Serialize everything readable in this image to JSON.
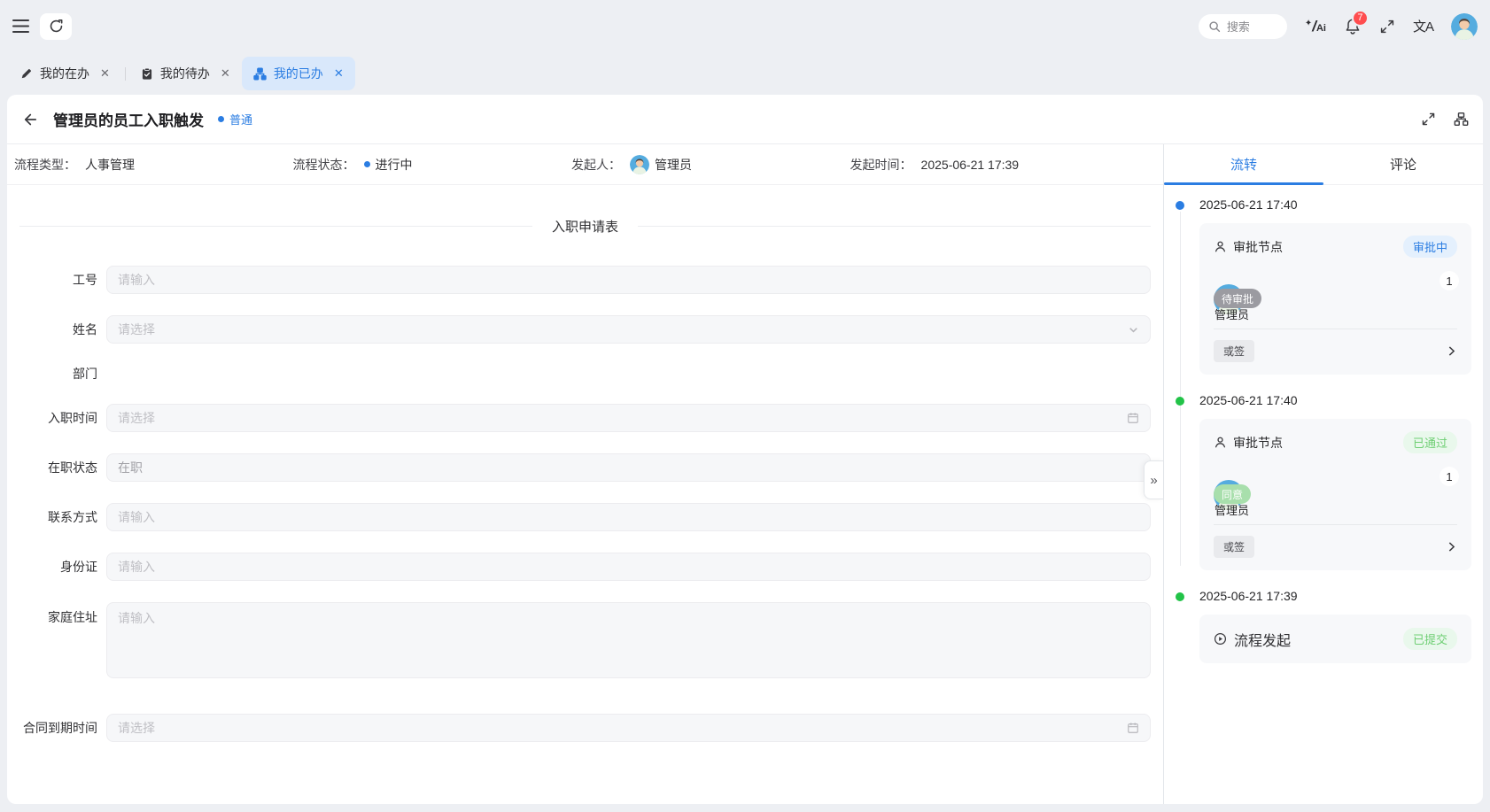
{
  "colors": {
    "accent": "#2b7de2",
    "accent_light_bg": "#d9e8fb",
    "success": "#22c348",
    "success_text": "#6fcf74",
    "success_bg": "#e9f8ec",
    "danger": "#ff4d4f",
    "pending_gray": "#9b9ba1",
    "agree_green": "#a8dfac"
  },
  "icons": {
    "menu-icon": "hamburger",
    "refresh-icon": "circular-arrow",
    "search-icon": "magnifier",
    "ai-assistant-icon": "sparkle-slash-Ai",
    "bell-icon": "bell",
    "fullscreen-icon": "corner-arrows",
    "translate-icon": "文A",
    "pencil-icon": "edit-pen",
    "clipboard-check-icon": "task-board",
    "flowchart-icon": "org-chart",
    "back-arrow-icon": "left-arrow",
    "person-icon": "user-outline",
    "play-circle-icon": "circled-play",
    "calendar-icon": "calendar",
    "chevron-down-icon": "v",
    "chevron-right-icon": ">",
    "collapse-icon": "»"
  },
  "topbar": {
    "search_placeholder": "搜索",
    "notification_count": "7",
    "ai_label": "Ai",
    "translate_label": "文A"
  },
  "tabs": [
    {
      "label": "我的在办"
    },
    {
      "label": "我的待办"
    },
    {
      "label": "我的已办"
    }
  ],
  "page": {
    "title": "管理员的员工入职触发",
    "priority_badge": "普通"
  },
  "meta": {
    "type_label": "流程类型：",
    "type_value": "人事管理",
    "status_label": "流程状态：",
    "status_value": "进行中",
    "initiator_label": "发起人：",
    "initiator_value": "管理员",
    "time_label": "发起时间：",
    "time_value": "2025-06-21 17:39"
  },
  "form": {
    "title": "入职申请表",
    "fields": [
      {
        "label": "工号",
        "placeholder": "请输入",
        "type": "input"
      },
      {
        "label": "姓名",
        "placeholder": "请选择",
        "type": "select"
      },
      {
        "label": "部门",
        "type": "label-only"
      },
      {
        "label": "入职时间",
        "placeholder": "请选择",
        "type": "date"
      },
      {
        "label": "在职状态",
        "value": "在职",
        "type": "input"
      },
      {
        "label": "联系方式",
        "placeholder": "请输入",
        "type": "input"
      },
      {
        "label": "身份证",
        "placeholder": "请输入",
        "type": "input"
      },
      {
        "label": "家庭住址",
        "placeholder": "请输入",
        "type": "textarea"
      },
      {
        "label": "合同到期时间",
        "placeholder": "请选择",
        "type": "date"
      }
    ]
  },
  "panel": {
    "tabs": [
      {
        "label": "流转"
      },
      {
        "label": "评论"
      }
    ],
    "timeline": [
      {
        "date": "2025-06-21 17:40",
        "dot": "blue",
        "node_label": "审批节点",
        "status_badge": "审批中",
        "person_name": "管理员",
        "person_status": "待审批",
        "count": "1",
        "sign_mode": "或签"
      },
      {
        "date": "2025-06-21 17:40",
        "dot": "green",
        "node_label": "审批节点",
        "status_badge": "已通过",
        "person_name": "管理员",
        "person_status": "同意",
        "count": "1",
        "sign_mode": "或签"
      },
      {
        "date": "2025-06-21 17:39",
        "dot": "green",
        "node_label": "流程发起",
        "status_badge": "已提交"
      }
    ]
  }
}
